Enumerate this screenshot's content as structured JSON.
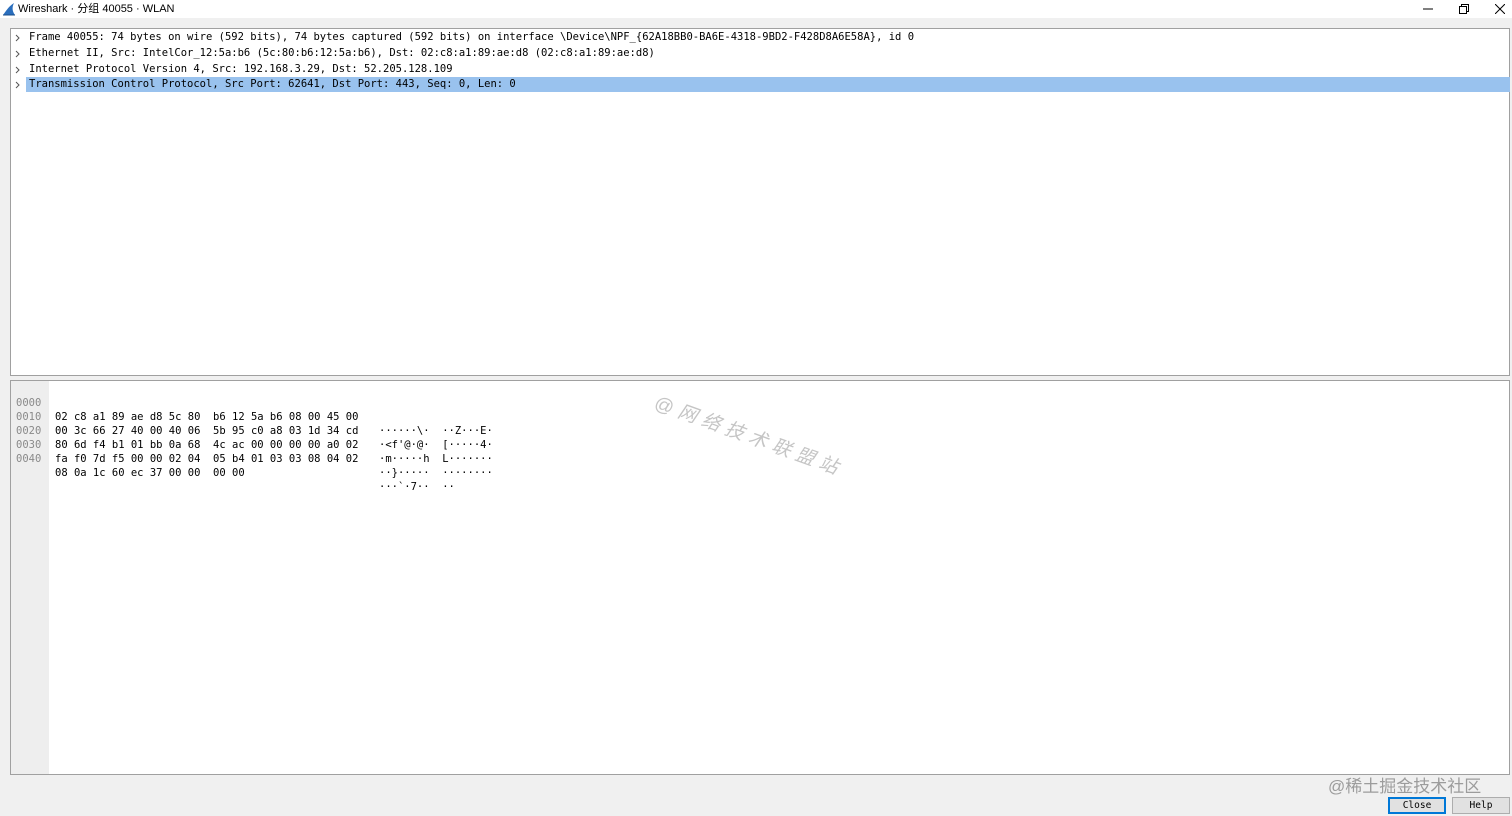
{
  "window": {
    "title": "Wireshark · 分组 40055 · WLAN",
    "brand_color": "#2a6ebd"
  },
  "details": {
    "rows": [
      {
        "text": "Frame 40055: 74 bytes on wire (592 bits), 74 bytes captured (592 bits) on interface \\Device\\NPF_{62A18BB0-BA6E-4318-9BD2-F428D8A6E58A}, id 0",
        "selected": false
      },
      {
        "text": "Ethernet II, Src: IntelCor_12:5a:b6 (5c:80:b6:12:5a:b6), Dst: 02:c8:a1:89:ae:d8 (02:c8:a1:89:ae:d8)",
        "selected": false
      },
      {
        "text": "Internet Protocol Version 4, Src: 192.168.3.29, Dst: 52.205.128.109",
        "selected": false
      },
      {
        "text": "Transmission Control Protocol, Src Port: 62641, Dst Port: 443, Seq: 0, Len: 0",
        "selected": true
      }
    ],
    "selection_color": "#99c2ee"
  },
  "bytes": {
    "rows": [
      {
        "offset": "0000",
        "hex": "02 c8 a1 89 ae d8 5c 80  b6 12 5a b6 08 00 45 00",
        "ascii": "······\\·  ··Z···E·"
      },
      {
        "offset": "0010",
        "hex": "00 3c 66 27 40 00 40 06  5b 95 c0 a8 03 1d 34 cd",
        "ascii": "·<f'@·@·  [·····4·"
      },
      {
        "offset": "0020",
        "hex": "80 6d f4 b1 01 bb 0a 68  4c ac 00 00 00 00 a0 02",
        "ascii": "·m·····h  L·······"
      },
      {
        "offset": "0030",
        "hex": "fa f0 7d f5 00 00 02 04  05 b4 01 03 03 08 04 02",
        "ascii": "··}·····  ········"
      },
      {
        "offset": "0040",
        "hex": "08 0a 1c 60 ec 37 00 00  00 00",
        "ascii": "···`·7··  ··"
      }
    ]
  },
  "watermarks": {
    "diagonal": "@网络技术联盟站",
    "corner": "@稀土掘金技术社区"
  },
  "buttons": {
    "close": "Close",
    "help": "Help"
  }
}
